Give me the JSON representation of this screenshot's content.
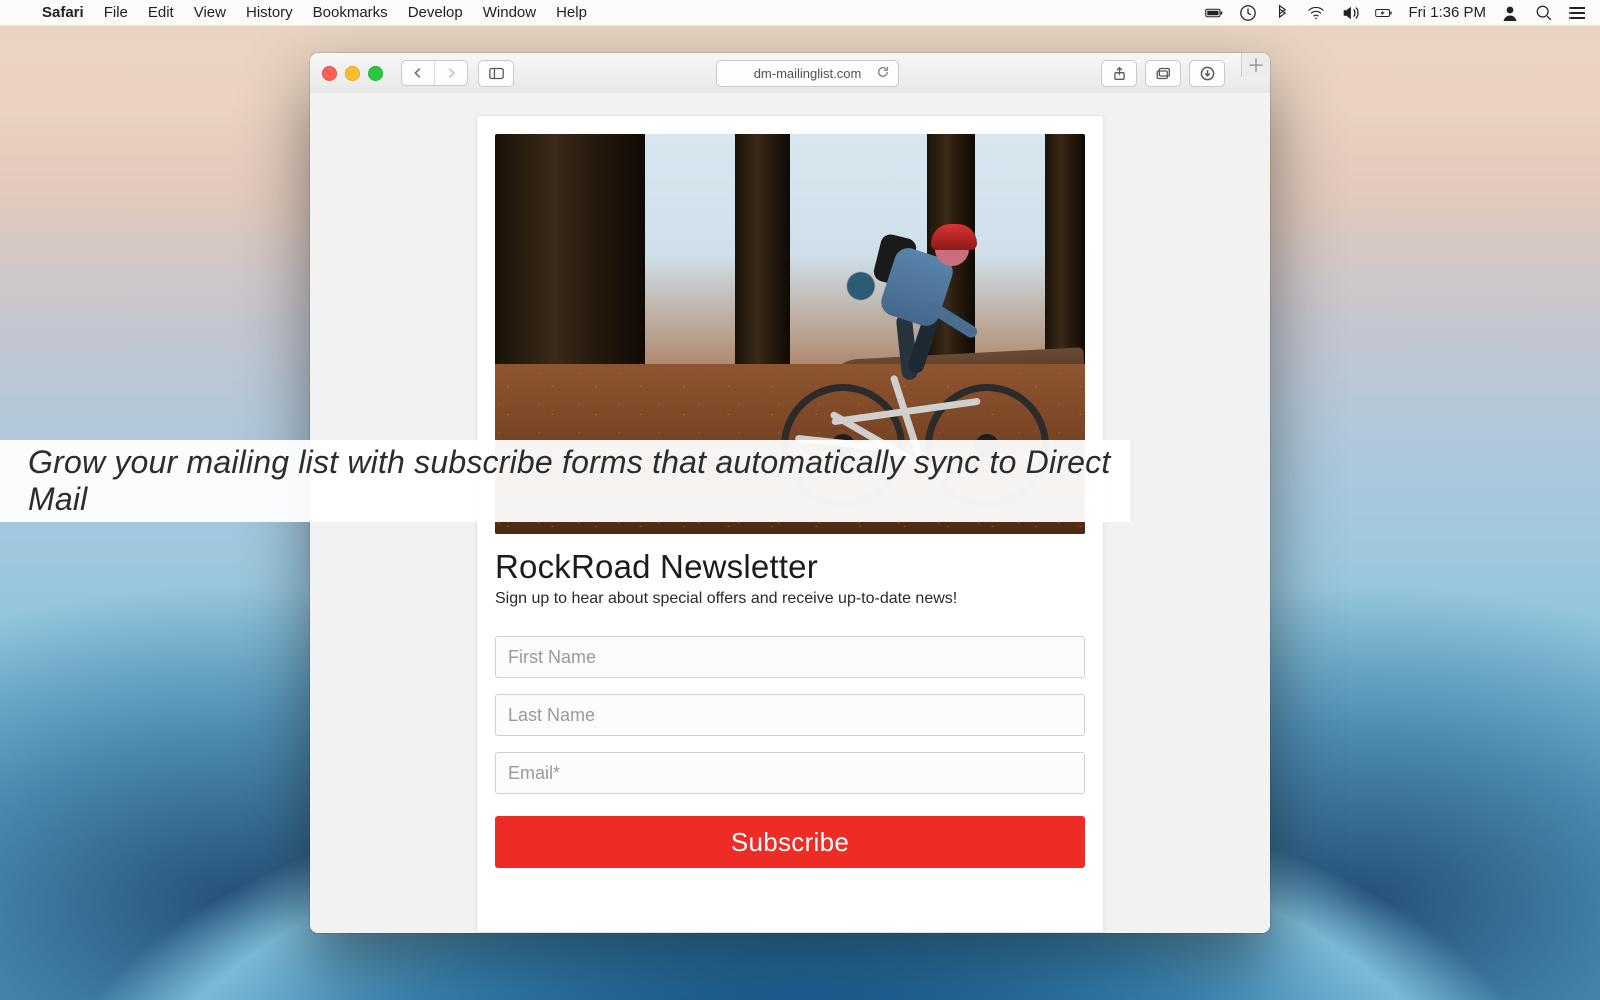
{
  "menubar": {
    "app": "Safari",
    "items": [
      "File",
      "Edit",
      "View",
      "History",
      "Bookmarks",
      "Develop",
      "Window",
      "Help"
    ],
    "clock": "Fri 1:36 PM"
  },
  "browser": {
    "url": "dm-mailinglist.com"
  },
  "form": {
    "title": "RockRoad Newsletter",
    "subtitle": "Sign up to hear about special offers and receive up-to-date news!",
    "first_name_ph": "First Name",
    "last_name_ph": "Last Name",
    "email_ph": "Email*",
    "submit": "Subscribe"
  },
  "overlay": {
    "caption": "Grow your mailing list with subscribe forms that automatically sync to Direct Mail"
  }
}
